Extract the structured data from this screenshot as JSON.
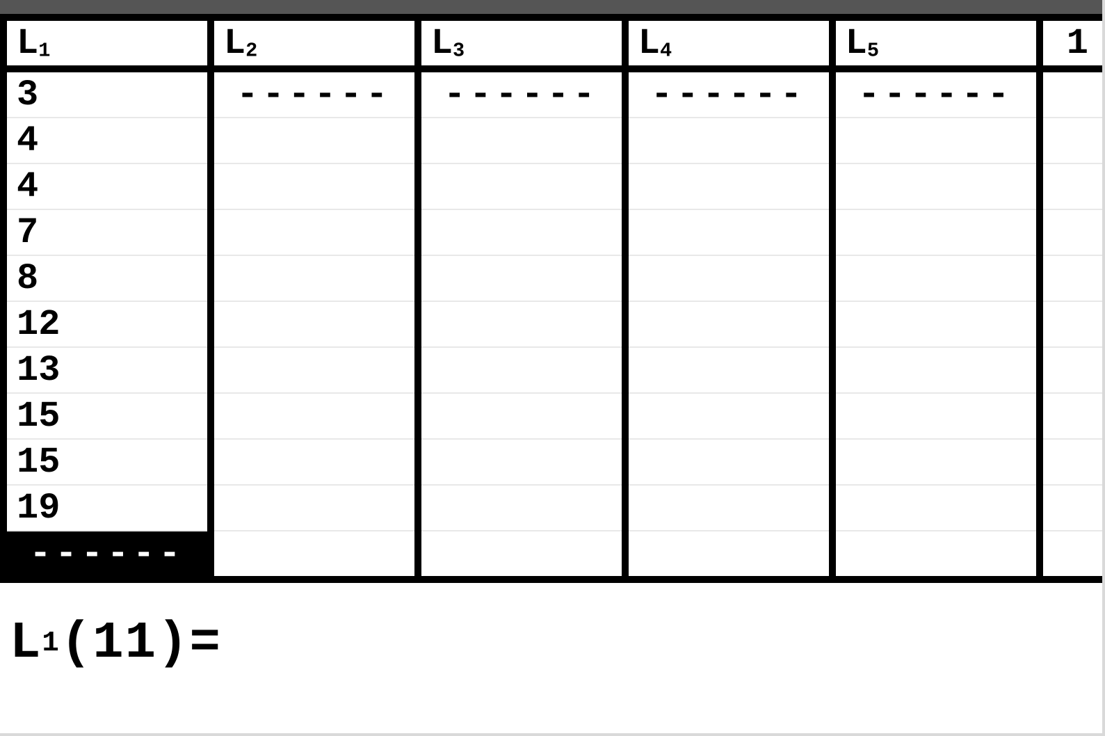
{
  "columns": [
    {
      "label_main": "L",
      "label_sub": "1"
    },
    {
      "label_main": "L",
      "label_sub": "2"
    },
    {
      "label_main": "L",
      "label_sub": "3"
    },
    {
      "label_main": "L",
      "label_sub": "4"
    },
    {
      "label_main": "L",
      "label_sub": "5"
    }
  ],
  "row_index_start": "1",
  "lists": {
    "L1": [
      "3",
      "4",
      "4",
      "7",
      "8",
      "12",
      "13",
      "15",
      "15",
      "19"
    ],
    "L2": [],
    "L3": [],
    "L4": [],
    "L5": []
  },
  "visible_rows": 11,
  "cursor": {
    "list": 0,
    "row": 10
  },
  "empty_placeholder": "------",
  "status": {
    "list_main": "L",
    "list_sub": "1",
    "index": "11",
    "equals": "=",
    "value": ""
  }
}
